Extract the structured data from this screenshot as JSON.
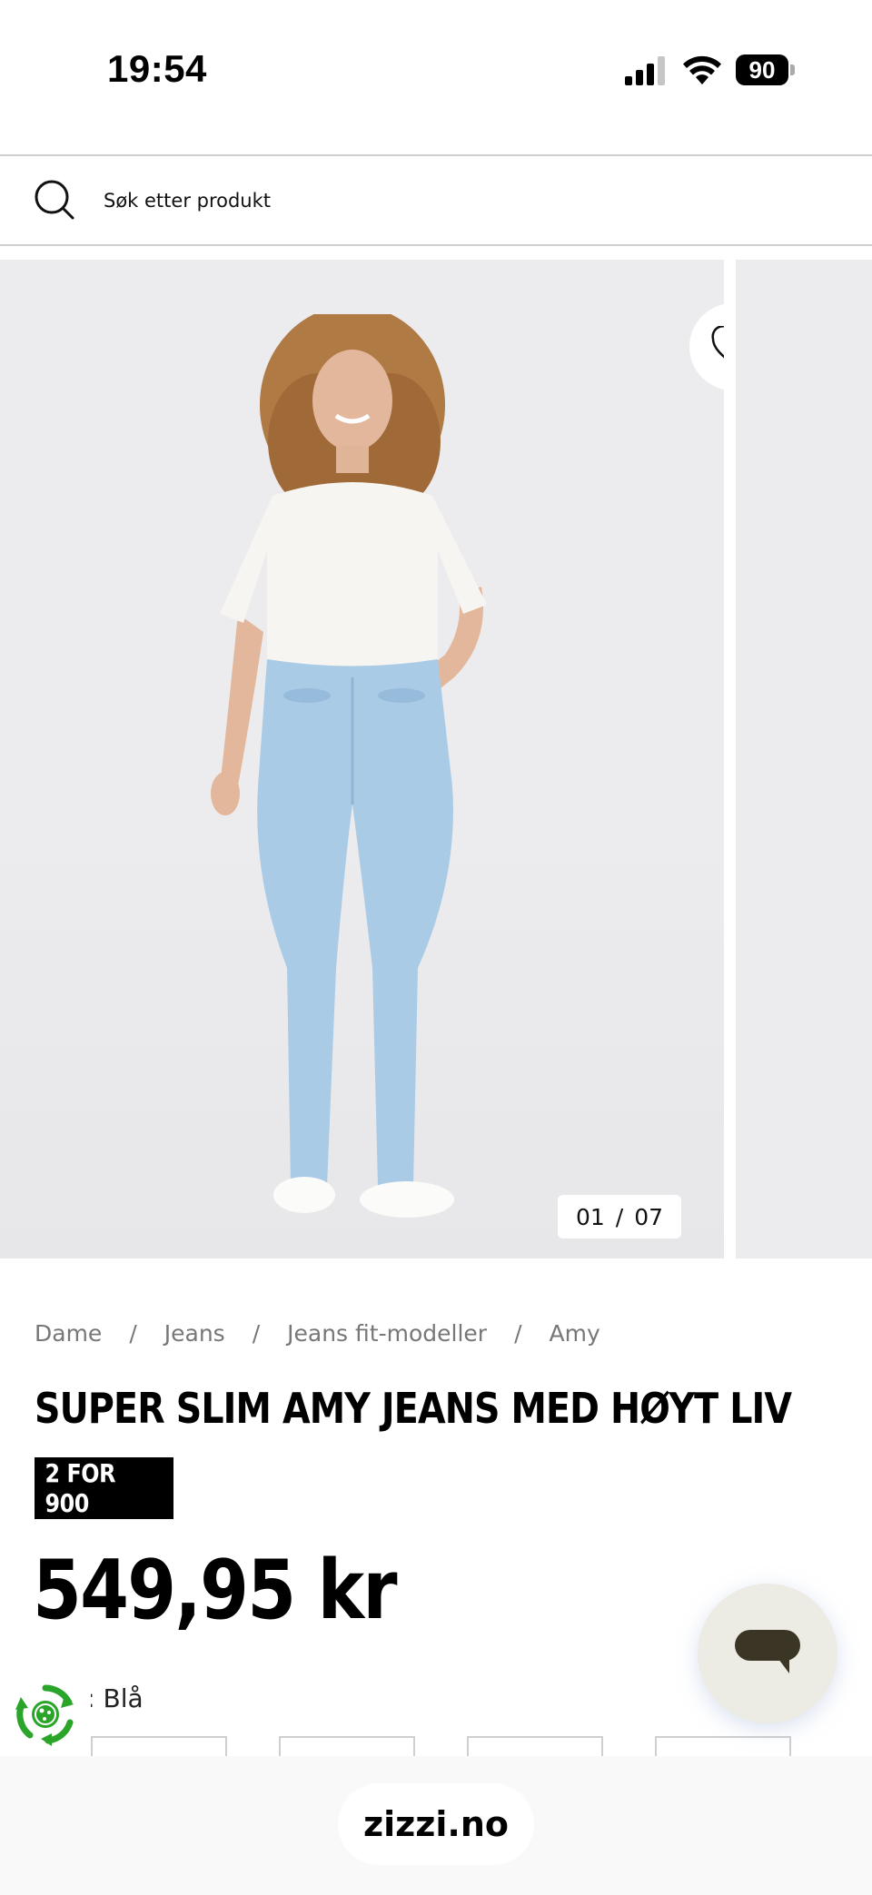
{
  "status_bar": {
    "time": "19:54",
    "battery": "90"
  },
  "search": {
    "placeholder": "Søk etter produkt"
  },
  "gallery": {
    "counter_current": "01",
    "counter_separator": "/",
    "counter_total": "07",
    "favorite_icon": "heart-icon"
  },
  "breadcrumb": {
    "items": [
      "Dame",
      "Jeans",
      "Jeans fit-modeller",
      "Amy"
    ],
    "separator": "/"
  },
  "product": {
    "title": "SUPER SLIM AMY JEANS MED HØYT LIV",
    "promo": "2 FOR 900",
    "price": "549,95 kr",
    "color_label": "e: Blå"
  },
  "browser": {
    "url": "zizzi.no"
  },
  "colors": {
    "promo_background": "#000000",
    "photo_background": "#ececee",
    "denim": "#a9cbe6",
    "eco_green": "#2aa52a",
    "chat_button": "#ecebe4",
    "chat_icon": "#3b3525"
  }
}
